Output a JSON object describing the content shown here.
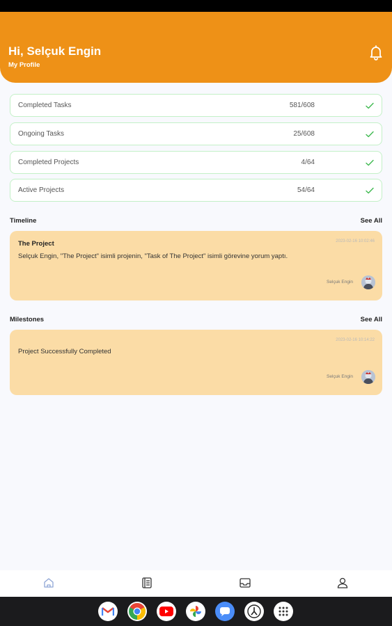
{
  "header": {
    "greeting": "Hi, Selçuk Engin",
    "profile_link": "My Profile",
    "bell_icon": "bell-icon"
  },
  "stats": [
    {
      "label": "Completed Tasks",
      "value": "581/608"
    },
    {
      "label": "Ongoing Tasks",
      "value": "25/608"
    },
    {
      "label": "Completed Projects",
      "value": "4/64"
    },
    {
      "label": "Active Projects",
      "value": "54/64"
    }
  ],
  "timeline": {
    "title": "Timeline",
    "see_all": "See All",
    "items": [
      {
        "title": "The Project",
        "text": "Selçuk Engin, \"The Project\" isimli projenin, \"Task of The Project\" isimli görevine yorum yaptı.",
        "date": "2023-02-16 10:02:46",
        "author": "Selçuk Engin"
      }
    ]
  },
  "milestones": {
    "title": "Milestones",
    "see_all": "See All",
    "items": [
      {
        "text": "Project Successfully Completed",
        "date": "2023-02-16 10:14:22",
        "author": "Selçuk Engin"
      }
    ]
  },
  "bottom_nav": [
    "home-icon",
    "tasks-icon",
    "projects-icon",
    "profile-icon"
  ],
  "dock": [
    "gmail-icon",
    "chrome-icon",
    "youtube-icon",
    "photos-icon",
    "messages-icon",
    "clock-icon",
    "app-drawer-icon"
  ],
  "colors": {
    "accent": "#ee9117",
    "card": "#fbdca6",
    "success": "#3fb950",
    "nav_active": "#8fa6d6"
  }
}
